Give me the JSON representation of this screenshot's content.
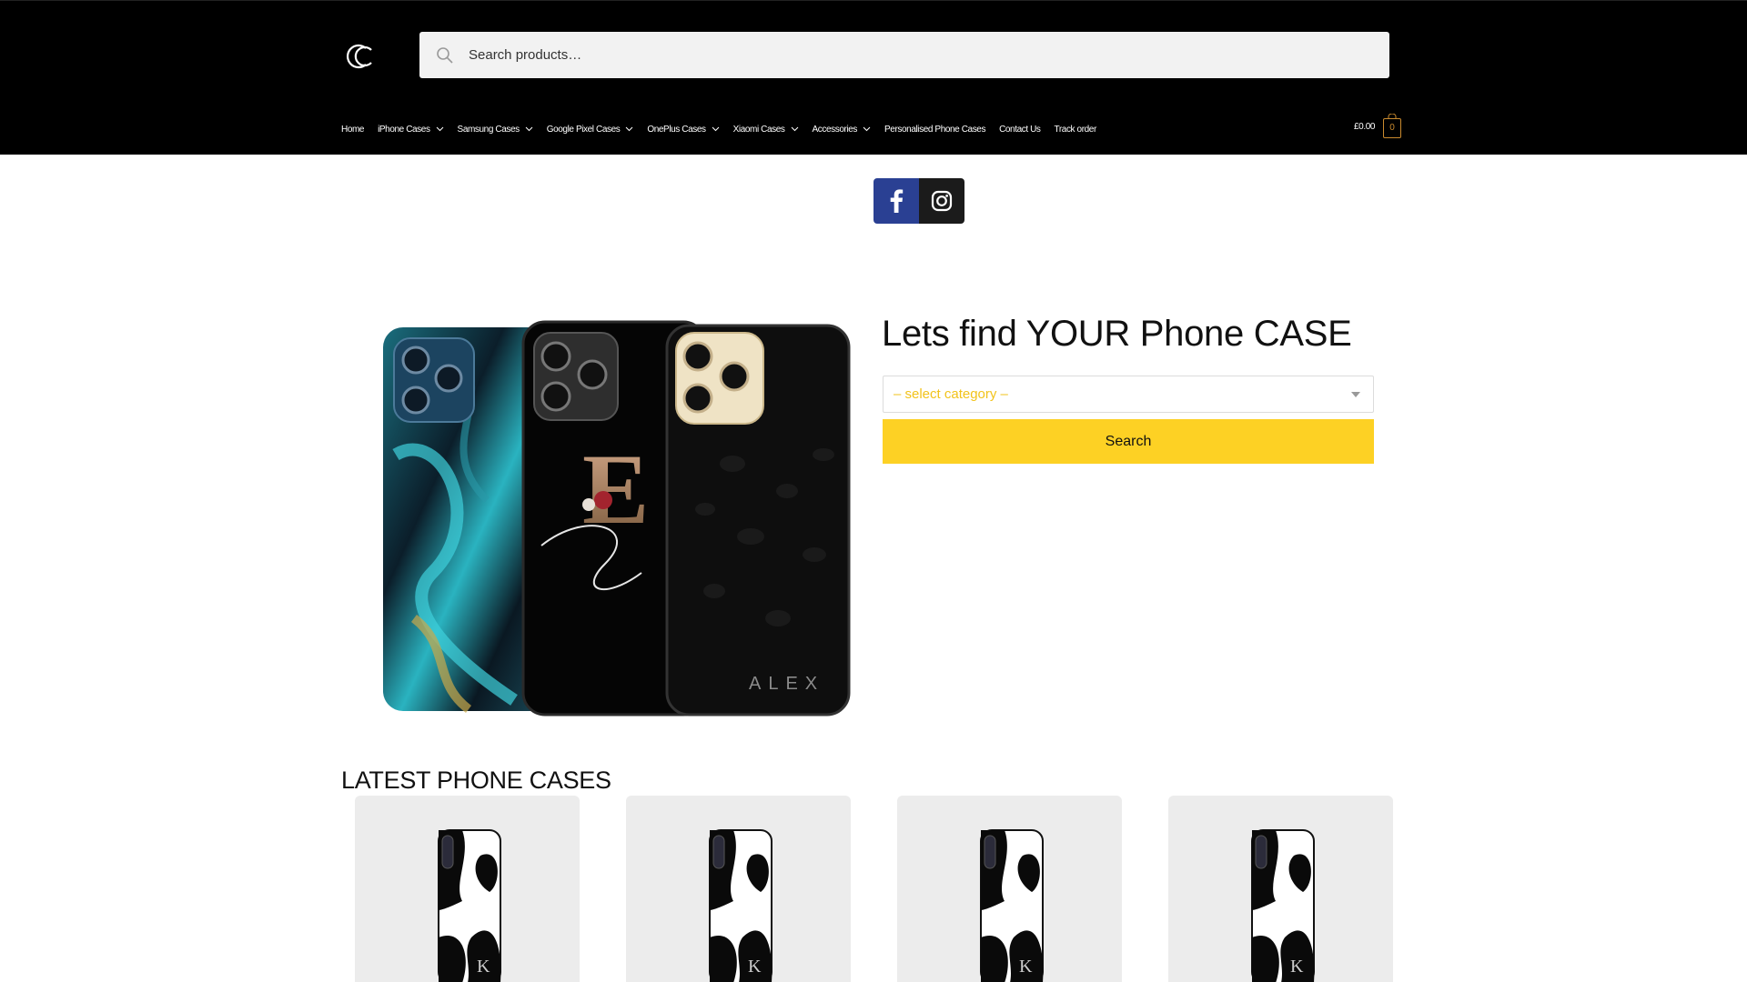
{
  "header": {
    "logo_icon": "logo-c-icon",
    "search": {
      "placeholder": "Search products…",
      "icon": "search-icon"
    }
  },
  "nav": {
    "items": [
      {
        "label": "Home",
        "dropdown": false
      },
      {
        "label": "iPhone Cases",
        "dropdown": true
      },
      {
        "label": "Samsung Cases",
        "dropdown": true
      },
      {
        "label": "Google Pixel Cases",
        "dropdown": true
      },
      {
        "label": "OnePlus Cases",
        "dropdown": true
      },
      {
        "label": "Xiaomi Cases",
        "dropdown": true
      },
      {
        "label": "Accessories",
        "dropdown": true
      },
      {
        "label": "Personalised Phone Cases",
        "dropdown": false
      },
      {
        "label": "Contact Us",
        "dropdown": false
      },
      {
        "label": "Track order",
        "dropdown": false
      }
    ]
  },
  "cart": {
    "amount": "£0.00",
    "count": "0",
    "accent": "#c98a2e"
  },
  "social": {
    "facebook_icon": "facebook-icon",
    "instagram_icon": "instagram-icon",
    "facebook_color": "#2a4093",
    "instagram_color": "#1b1b1b"
  },
  "hero": {
    "title": "Lets find YOUR Phone CASE",
    "select_placeholder": "– select category –",
    "search_button": "Search",
    "button_color": "#fdd124",
    "image_texts": {
      "case_name": "ALEX",
      "monogram": "E"
    }
  },
  "latest": {
    "title": "LATEST PHONE CASES",
    "products": [
      {
        "initial": "K"
      },
      {
        "initial": "K"
      },
      {
        "initial": "K"
      },
      {
        "initial": "K"
      }
    ]
  }
}
